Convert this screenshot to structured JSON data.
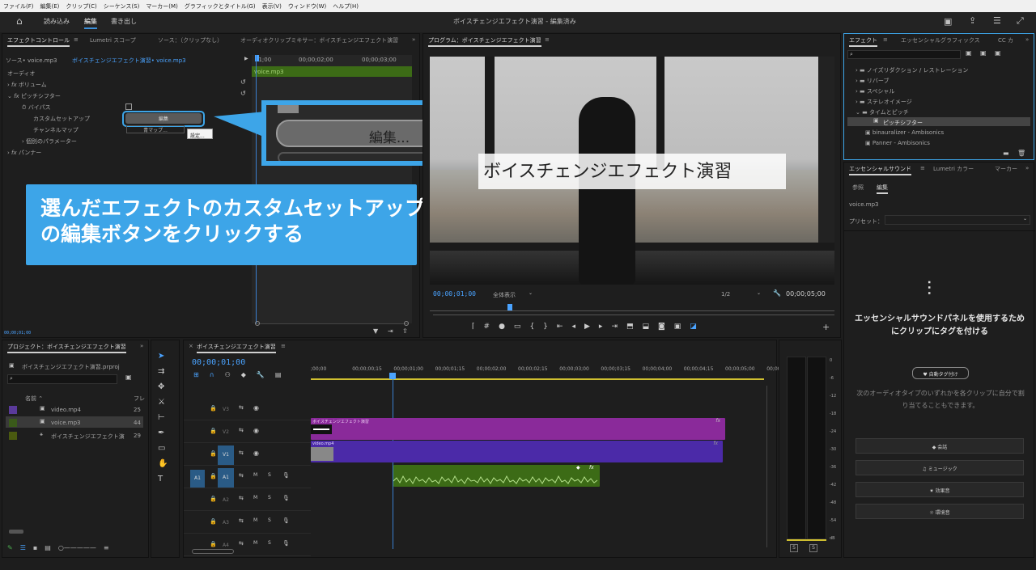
{
  "menu": [
    "ファイル(F)",
    "編集(E)",
    "クリップ(C)",
    "シーケンス(S)",
    "マーカー(M)",
    "グラフィックとタイトル(G)",
    "表示(V)",
    "ウィンドウ(W)",
    "ヘルプ(H)"
  ],
  "workspace": {
    "tabs": [
      "読み込み",
      "編集",
      "書き出し"
    ],
    "title": "ボイスチェンジエフェクト演習 - 編集済み"
  },
  "effect_controls": {
    "tabs": [
      "エフェクトコントロール",
      "Lumetri スコープ",
      "ソース：（クリップなし）",
      "オーディオクリップミキサー：ボイスチェンジエフェクト演習"
    ],
    "source": "ソース• voice.mp3",
    "sequence": "ボイスチェンジエフェクト演習• voice.mp3",
    "time_marks": [
      "01;00",
      "00;00;02;00",
      "00;00;03;00"
    ],
    "clip_label": "voice.mp3",
    "section": "オーディオ",
    "items": [
      "ボリューム",
      "ピッチシフター",
      "バイパス",
      "カスタムセットアップ",
      "チャンネルマップ",
      "個別のパラメーター",
      "パンナー"
    ],
    "edit_button": "編集",
    "channel_button": "青マップ...",
    "tooltip": "設定...",
    "bottom_time": "00;00;01;00"
  },
  "zoom_callout": {
    "button_label": "編集..."
  },
  "instruction": {
    "line1": "選んだエフェクトのカスタムセットアップ",
    "line2": "の編集ボタンをクリックする"
  },
  "program": {
    "tab": "プログラム：ボイスチェンジエフェクト演習",
    "caption": "ボイスチェンジエフェクト演習",
    "timecode": "00;00;01;00",
    "fit": "全体表示",
    "quality": "1/2",
    "duration": "00;00;05;00"
  },
  "effects_panel": {
    "tabs": [
      "エフェクト",
      "エッセンシャルグラフィックス",
      "CC カ"
    ],
    "search_placeholder": "",
    "items": [
      "ノイズリダクション / レストレーション",
      "リバーブ",
      "スペシャル",
      "ステレオイメージ",
      "タイムとピッチ",
      "ピッチシフター",
      "binauralizer - Ambisonics",
      "Panner - Ambisonics"
    ]
  },
  "essential_sound": {
    "tabs": [
      "エッセンシャルサウンド",
      "Lumetri カラー",
      "マーカー"
    ],
    "subtabs": [
      "参照",
      "編集"
    ],
    "clip": "voice.mp3",
    "preset_label": "プリセット：",
    "heading": "エッセンシャルサウンドパネルを使用するためにクリップにタグを付ける",
    "auto_tag": "自動タグ付け",
    "description": "次のオーディオタイプのいずれかを各クリップに自分で割り当てることもできます。",
    "types": [
      "会話",
      "ミュージック",
      "効果音",
      "環境音"
    ]
  },
  "project": {
    "tab": "プロジェクト：ボイスチェンジエフェクト演習",
    "file": "ボイスチェンジエフェクト演習.prproj",
    "col_name": "名前",
    "col_fr": "フレ",
    "items": [
      {
        "name": "video.mp4",
        "fr": "25",
        "color": "#5a3a9a"
      },
      {
        "name": "voice.mp3",
        "fr": "44",
        "color": "#3a5a1a"
      },
      {
        "name": "ボイスチェンジエフェクト演",
        "fr": "29",
        "color": "#4a5a10"
      }
    ]
  },
  "timeline": {
    "tab": "ボイスチェンジエフェクト演習",
    "timecode": "00;00;01;00",
    "ruler": [
      ";00;00",
      "00;00;00;15",
      "00;00;01;00",
      "00;00;01;15",
      "00;00;02;00",
      "00;00;02;15",
      "00;00;03;00",
      "00;00;03;15",
      "00;00;04;00",
      "00;00;04;15",
      "00;00;05;00",
      "00;00;05;15"
    ],
    "tracks": [
      "V3",
      "V2",
      "V1",
      "A1",
      "A2",
      "A3",
      "A4"
    ],
    "title_clip": "ボイスチェンジエフェクト演習",
    "video_clip": "video.mp4"
  },
  "meter": {
    "scale": [
      "0",
      "-6",
      "-12",
      "-18",
      "-24",
      "-30",
      "-36",
      "-42",
      "-48",
      "-54",
      "dB"
    ],
    "buttons": [
      "S",
      "S"
    ]
  }
}
